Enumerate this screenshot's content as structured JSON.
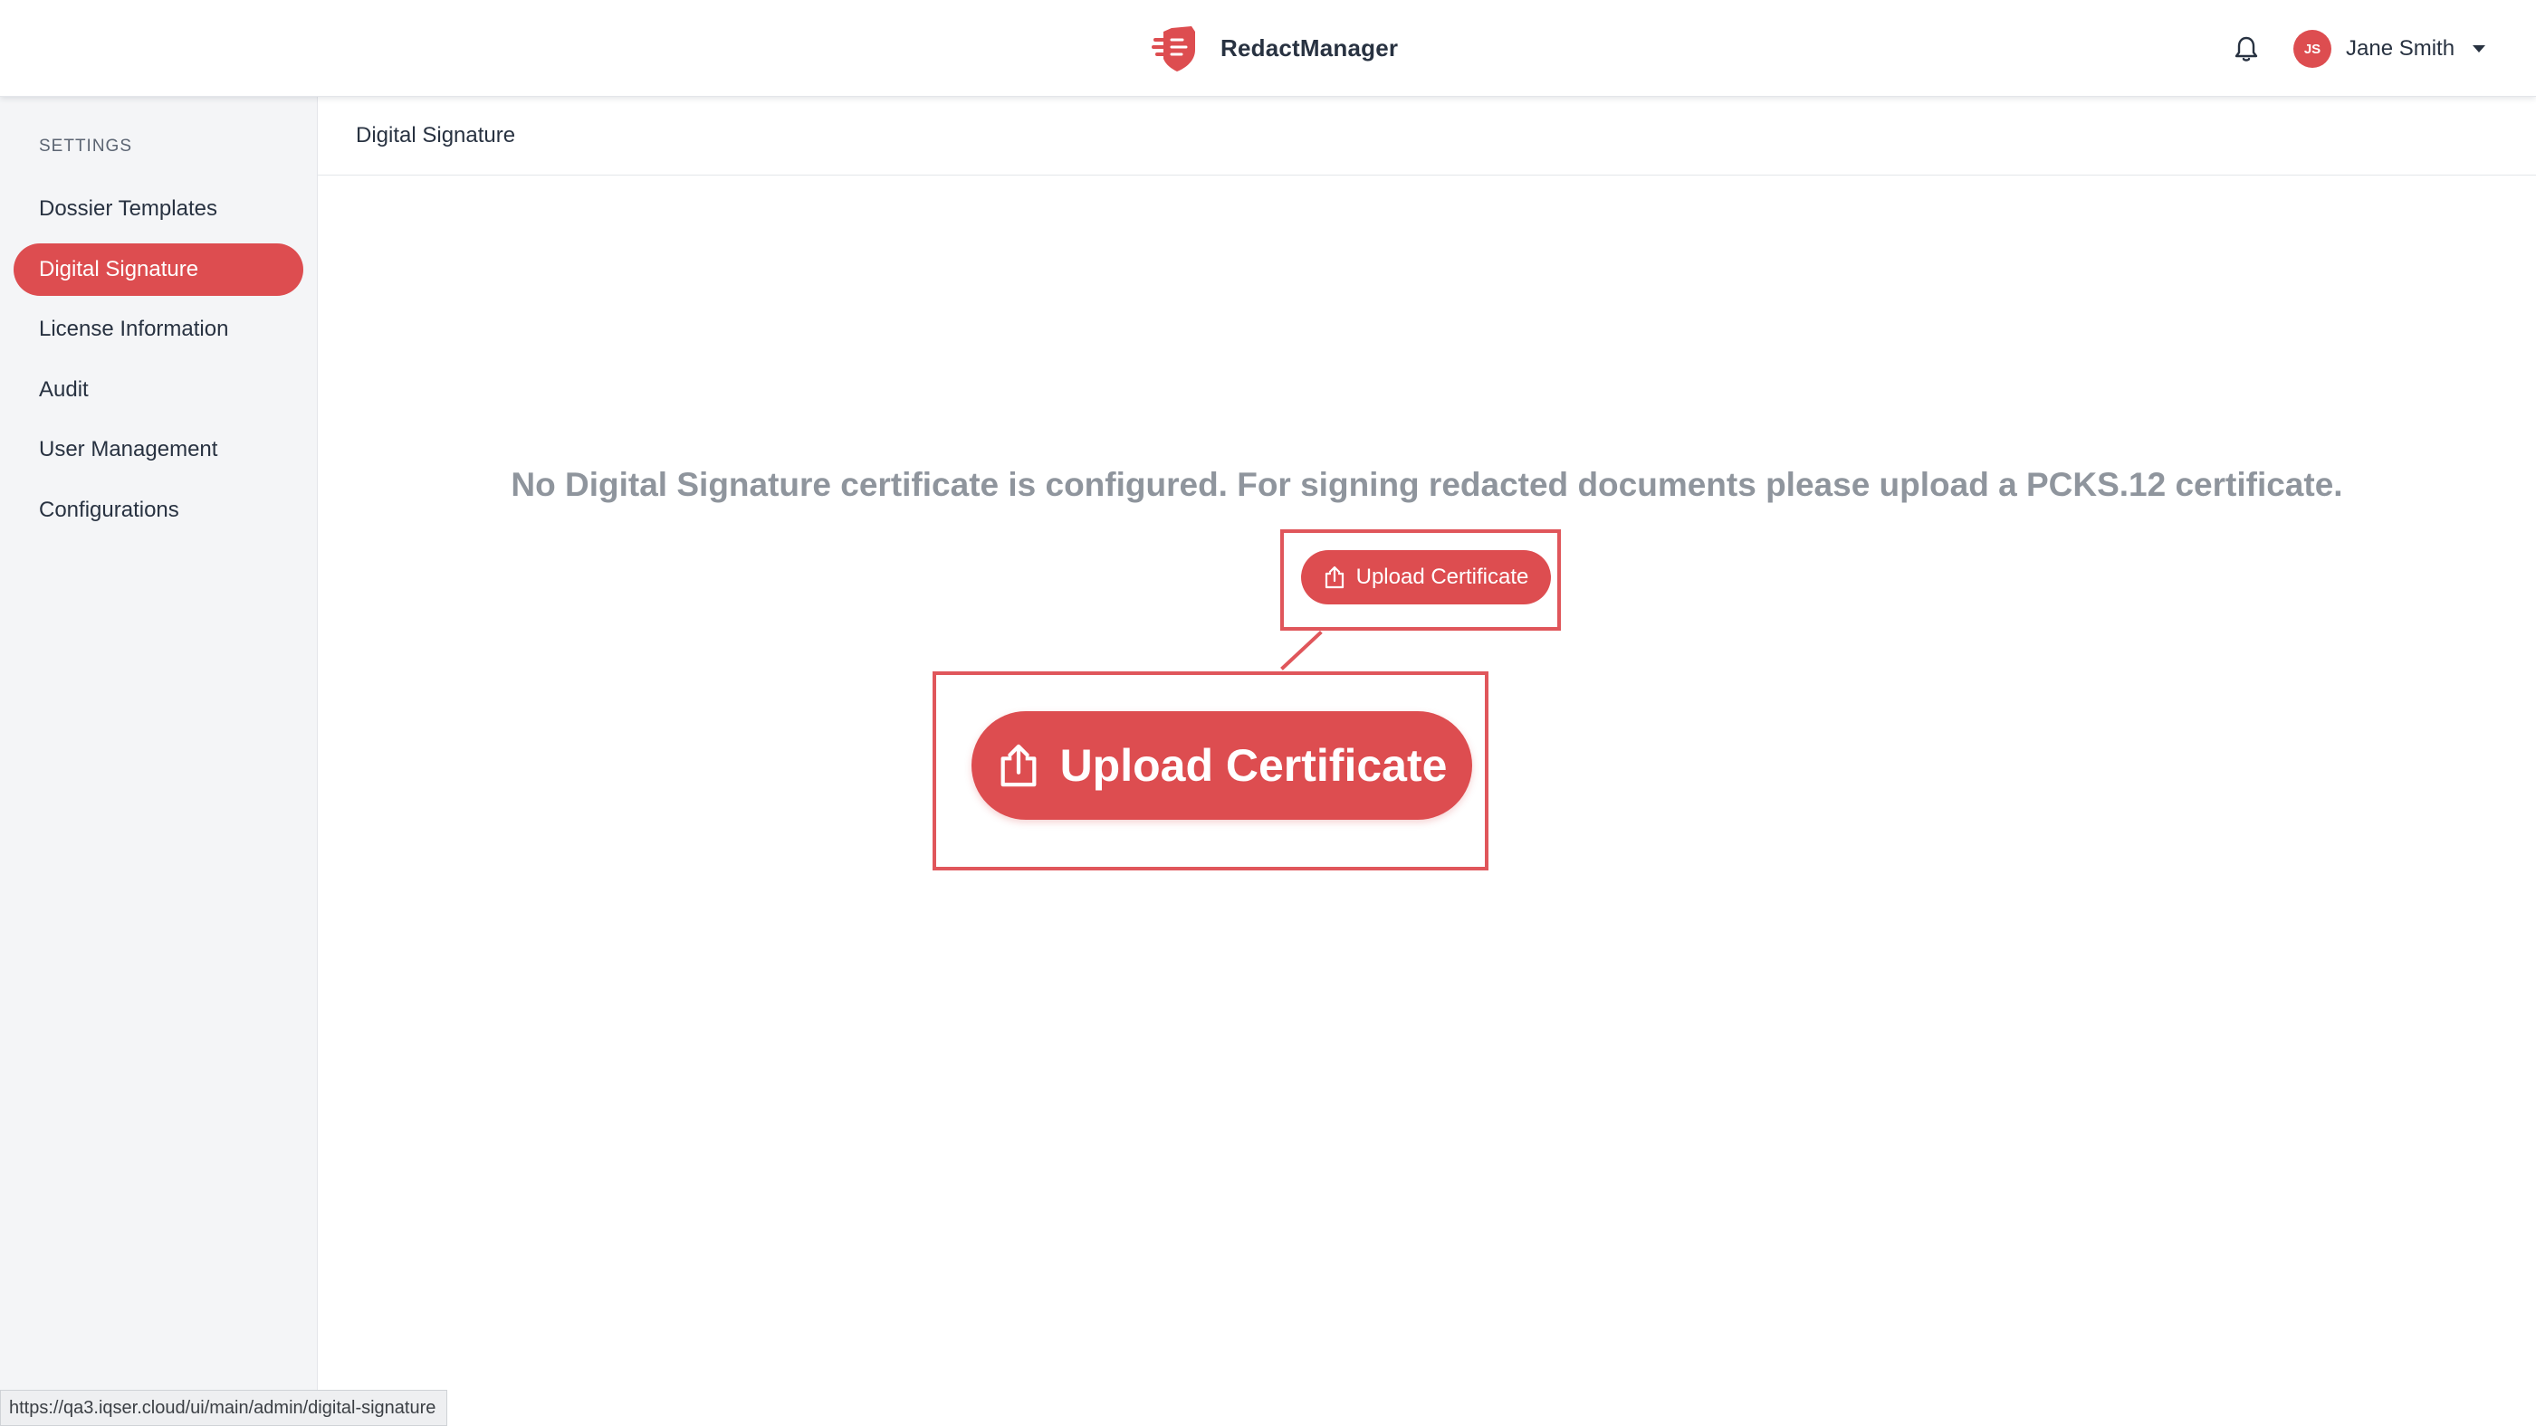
{
  "header": {
    "app_name": "RedactManager",
    "user": {
      "initials": "JS",
      "name": "Jane Smith"
    }
  },
  "sidebar": {
    "heading": "SETTINGS",
    "items": [
      {
        "label": "Dossier Templates",
        "active": false
      },
      {
        "label": "Digital Signature",
        "active": true
      },
      {
        "label": "License Information",
        "active": false
      },
      {
        "label": "Audit",
        "active": false
      },
      {
        "label": "User Management",
        "active": false
      },
      {
        "label": "Configurations",
        "active": false
      }
    ]
  },
  "main": {
    "title": "Digital Signature",
    "empty_message": "No Digital Signature certificate is configured. For signing redacted documents please upload a PCKS.12 certificate.",
    "upload_button_label": "Upload Certificate",
    "zoomed_button_label": "Upload Certificate"
  },
  "status_bar": {
    "url": "https://qa3.iqser.cloud/ui/main/admin/digital-signature"
  },
  "icons": {
    "logo": "shield-logo-icon",
    "notifications": "bell-icon",
    "user_menu": "chevron-down-icon",
    "upload": "upload-icon"
  },
  "colors": {
    "accent": "#dd4d50",
    "annotation_border": "#e0565b",
    "sidebar_bg": "#f4f5f7",
    "muted_text": "#8f959d"
  }
}
